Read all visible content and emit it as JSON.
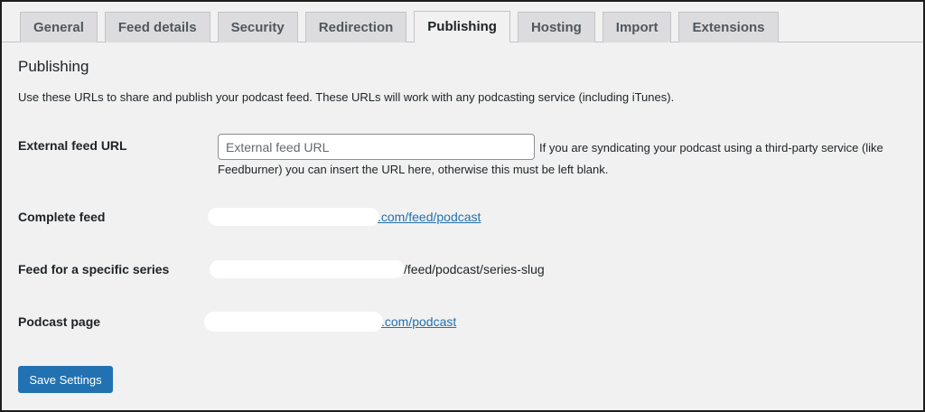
{
  "tabs": [
    {
      "label": "General",
      "active": false
    },
    {
      "label": "Feed details",
      "active": false
    },
    {
      "label": "Security",
      "active": false
    },
    {
      "label": "Redirection",
      "active": false
    },
    {
      "label": "Publishing",
      "active": true
    },
    {
      "label": "Hosting",
      "active": false
    },
    {
      "label": "Import",
      "active": false
    },
    {
      "label": "Extensions",
      "active": false
    }
  ],
  "section": {
    "title": "Publishing",
    "intro": "Use these URLs to share and publish your podcast feed. These URLs will work with any podcasting service (including iTunes)."
  },
  "external_feed": {
    "label": "External feed URL",
    "placeholder": "External feed URL",
    "value": "",
    "description_line1": "If you are syndicating your podcast using a third-party service (like",
    "description_line2": "Feedburner) you can insert the URL here, otherwise this must be left blank."
  },
  "complete_feed": {
    "label": "Complete feed",
    "link_text": ".com/feed/podcast"
  },
  "series_feed": {
    "label": "Feed for a specific series",
    "text": "/feed/podcast/series-slug"
  },
  "podcast_page": {
    "label": "Podcast page",
    "link_text": ".com/podcast"
  },
  "save_button": {
    "label": "Save Settings"
  },
  "colors": {
    "accent": "#2271b1",
    "background": "#f1f1f1"
  }
}
